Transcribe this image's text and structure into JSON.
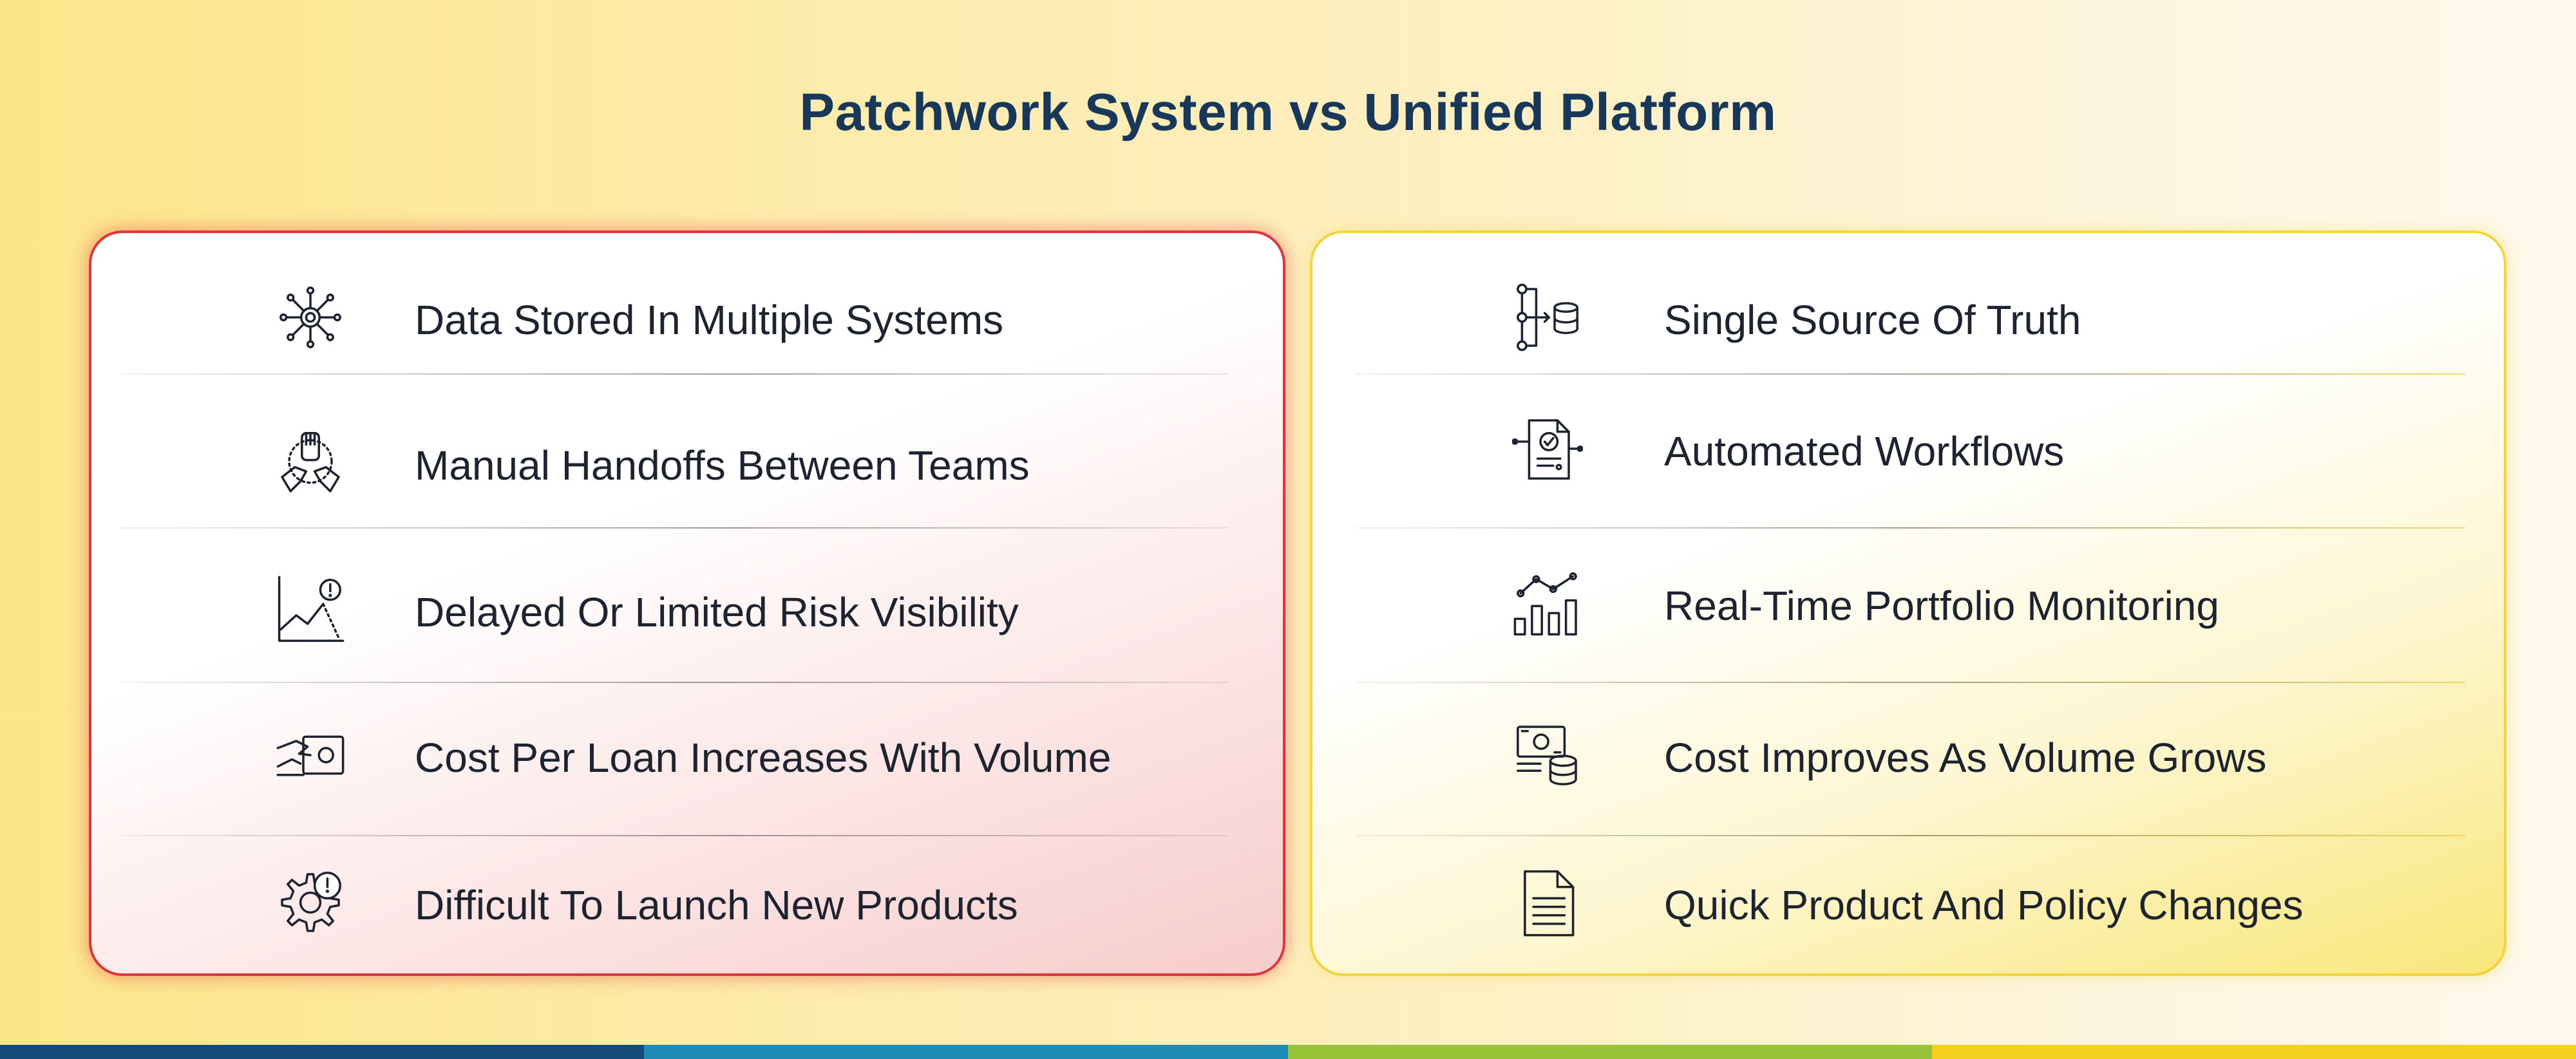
{
  "title": "Patchwork System vs Unified Platform",
  "left_card": {
    "border_color": "#e0343c",
    "items": [
      {
        "label": "Data Stored In Multiple Systems",
        "icon": "network-hub-icon"
      },
      {
        "label": "Manual Handoffs Between Teams",
        "icon": "team-hands-icon"
      },
      {
        "label": "Delayed Or Limited Risk Visibility",
        "icon": "risk-chart-icon"
      },
      {
        "label": "Cost Per Loan Increases With Volume",
        "icon": "cash-hand-icon"
      },
      {
        "label": "Difficult To Launch New Products",
        "icon": "gear-alert-icon"
      }
    ]
  },
  "right_card": {
    "border_color": "#f2d53a",
    "items": [
      {
        "label": "Single Source Of Truth",
        "icon": "database-flow-icon"
      },
      {
        "label": "Automated Workflows",
        "icon": "document-check-icon"
      },
      {
        "label": "Real-Time Portfolio Monitoring",
        "icon": "analytics-chart-icon"
      },
      {
        "label": "Cost Improves As Volume Grows",
        "icon": "money-stack-icon"
      },
      {
        "label": "Quick Product And Policy Changes",
        "icon": "document-icon"
      }
    ]
  },
  "bottom_bar_colors": [
    "#124a78",
    "#1d8bb5",
    "#98c43a",
    "#f4d21f"
  ]
}
